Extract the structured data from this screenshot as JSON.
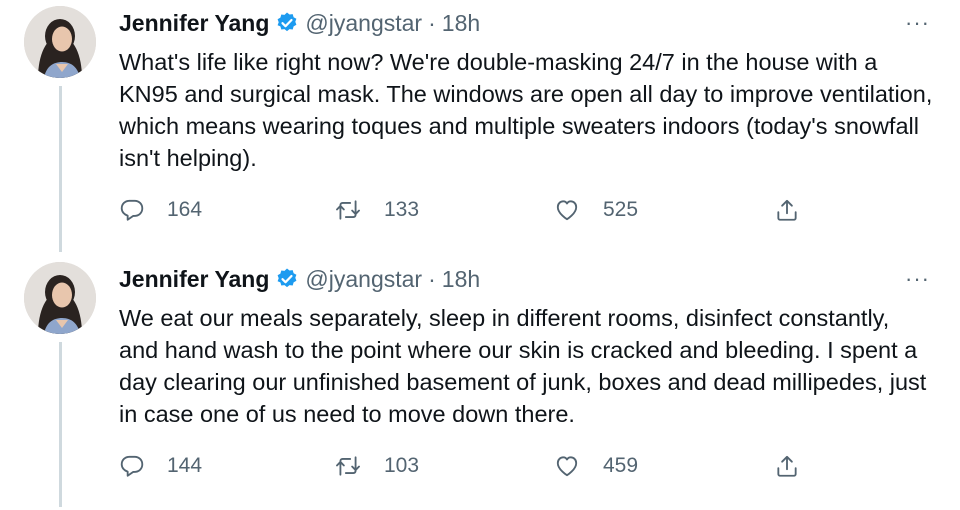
{
  "tweets": [
    {
      "author": {
        "name": "Jennifer Yang",
        "handle": "@jyangstar",
        "verified": true
      },
      "separator": "·",
      "time": "18h",
      "more": "···",
      "text": "What's life like right now? We're double-masking 24/7 in the house with a KN95 and surgical mask. The windows are open all day to improve ventilation, which means wearing toques and multiple sweaters indoors (today's snowfall isn't helping).",
      "replies": "164",
      "retweets": "133",
      "likes": "525"
    },
    {
      "author": {
        "name": "Jennifer Yang",
        "handle": "@jyangstar",
        "verified": true
      },
      "separator": "·",
      "time": "18h",
      "more": "···",
      "text": "We eat our meals separately, sleep in different rooms, disinfect constantly, and hand wash to the point where our skin is cracked and bleeding. I spent a day clearing our unfinished basement of junk, boxes and dead millipedes, just in case one of us need to move down there.",
      "replies": "144",
      "retweets": "103",
      "likes": "459"
    }
  ],
  "colors": {
    "verified_badge": "#1d9bf0",
    "secondary_text": "#536471",
    "primary_text": "#0f1419",
    "thread_line": "#cfd9de"
  },
  "icons": [
    "verified-badge-icon",
    "reply-icon",
    "retweet-icon",
    "like-icon",
    "share-icon",
    "more-icon"
  ]
}
